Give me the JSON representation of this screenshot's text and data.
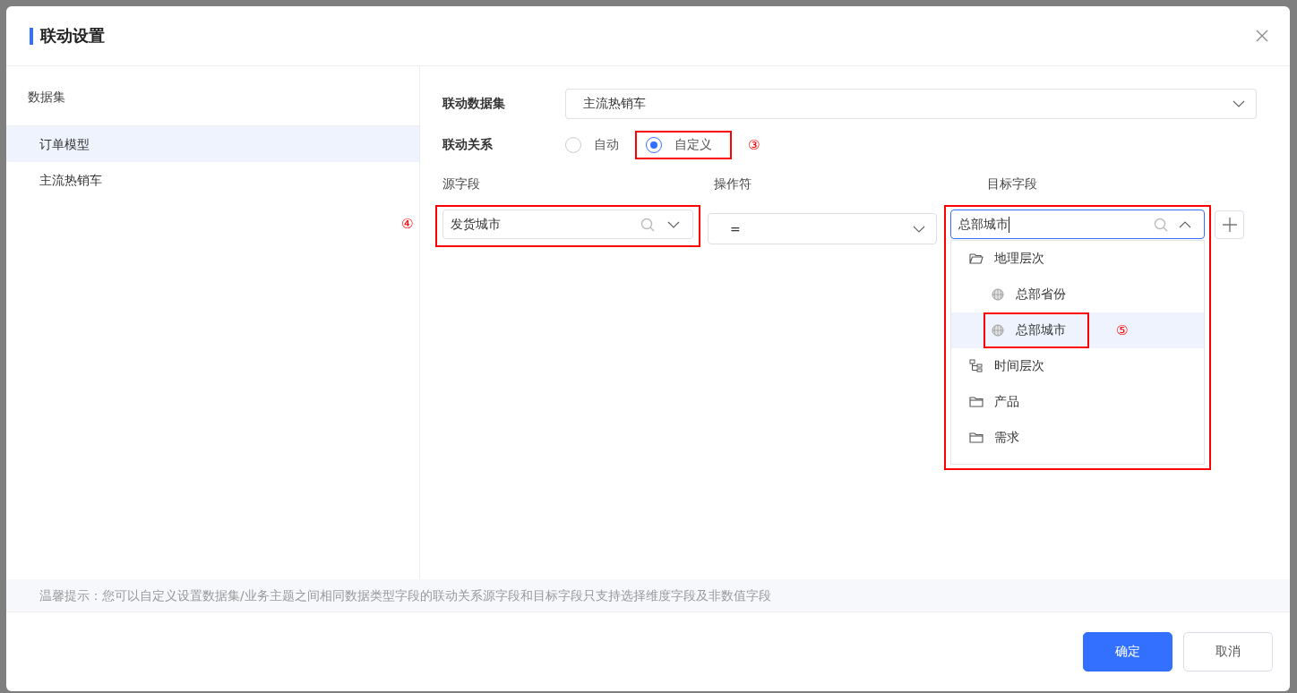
{
  "dialog": {
    "title": "联动设置"
  },
  "sidebar": {
    "heading": "数据集",
    "items": [
      {
        "label": "订单模型",
        "selected": true
      },
      {
        "label": "主流热销车",
        "selected": false
      }
    ]
  },
  "dataset": {
    "label": "联动数据集",
    "value": "主流热销车"
  },
  "relation": {
    "label": "联动关系",
    "marker": "③",
    "options": [
      {
        "label": "自动",
        "selected": false,
        "highlighted": false
      },
      {
        "label": "自定义",
        "selected": true,
        "highlighted": true
      }
    ]
  },
  "mapping": {
    "columns": [
      "源字段",
      "操作符",
      "目标字段"
    ],
    "source": {
      "value": "发货城市",
      "highlighted": true,
      "marker": "④"
    },
    "operator": {
      "value": "="
    },
    "target": {
      "value": "总部城市",
      "highlighted": true,
      "expanded": true,
      "options": [
        {
          "label": "地理层次",
          "kind": "folder-open",
          "selected": false,
          "highlighted": false,
          "children": [
            {
              "label": "总部省份",
              "kind": "geo",
              "selected": false,
              "highlighted": false
            },
            {
              "label": "总部城市",
              "kind": "geo",
              "selected": true,
              "highlighted": true,
              "marker": "⑤"
            }
          ]
        },
        {
          "label": "时间层次",
          "kind": "hierarchy",
          "selected": false,
          "highlighted": false
        },
        {
          "label": "产品",
          "kind": "folder",
          "selected": false,
          "highlighted": false
        },
        {
          "label": "需求",
          "kind": "folder",
          "selected": false,
          "highlighted": false
        }
      ]
    }
  },
  "tip": "温馨提示：您可以自定义设置数据集/业务主题之间相同数据类型字段的联动关系源字段和目标字段只支持选择维度字段及非数值字段",
  "buttons": [
    {
      "label": "确定",
      "kind": "primary"
    },
    {
      "label": "取消",
      "kind": "secondary"
    }
  ]
}
